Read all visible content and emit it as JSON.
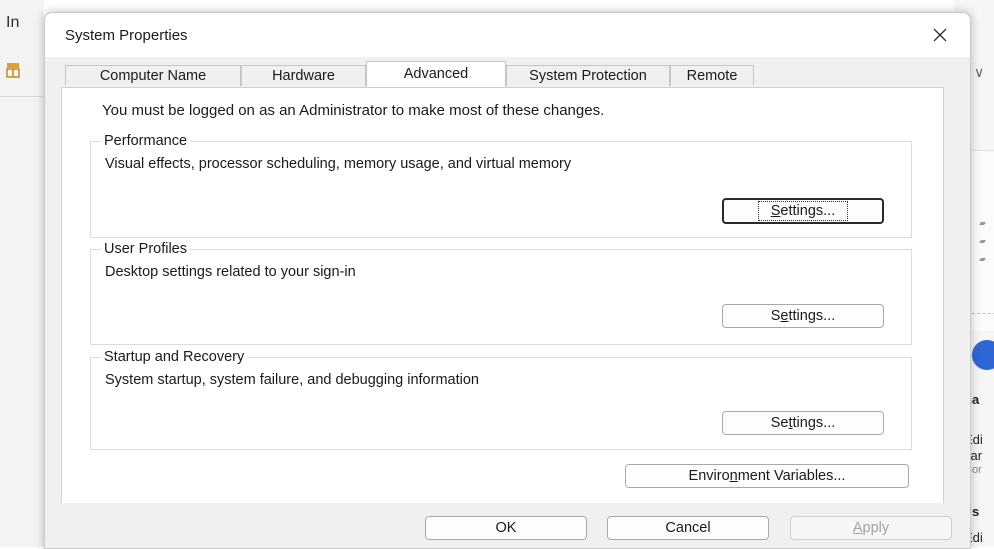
{
  "background": {
    "left_title": "In",
    "right_fragments": [
      "na",
      "Edi",
      "var",
      "Cor",
      "gs",
      "Edi"
    ]
  },
  "dialog": {
    "title": "System Properties",
    "tabs": [
      {
        "label": "Computer Name",
        "active": false
      },
      {
        "label": "Hardware",
        "active": false
      },
      {
        "label": "Advanced",
        "active": true
      },
      {
        "label": "System Protection",
        "active": false
      },
      {
        "label": "Remote",
        "active": false
      }
    ],
    "admin_note": "You must be logged on as an Administrator to make most of these changes.",
    "performance": {
      "label": "Performance",
      "description": "Visual effects, processor scheduling, memory usage, and virtual memory",
      "button": {
        "before": "",
        "accel": "S",
        "after": "ettings..."
      }
    },
    "user_profiles": {
      "label": "User Profiles",
      "description": "Desktop settings related to your sign-in",
      "button": {
        "before": "S",
        "accel": "e",
        "after": "ttings..."
      }
    },
    "startup_recovery": {
      "label": "Startup and Recovery",
      "description": "System startup, system failure, and debugging information",
      "button": {
        "before": "Se",
        "accel": "t",
        "after": "tings..."
      }
    },
    "env_button": {
      "before": "Enviro",
      "accel": "n",
      "after": "ment Variables..."
    },
    "footer": {
      "ok": "OK",
      "cancel": "Cancel",
      "apply": {
        "before": "",
        "accel": "A",
        "after": "pply"
      }
    }
  },
  "colors": {
    "dialog_bg": "#f0f0f0",
    "page_bg": "#ffffff",
    "accent_blue": "#2f66d6",
    "disabled_text": "#a3a3a3"
  }
}
